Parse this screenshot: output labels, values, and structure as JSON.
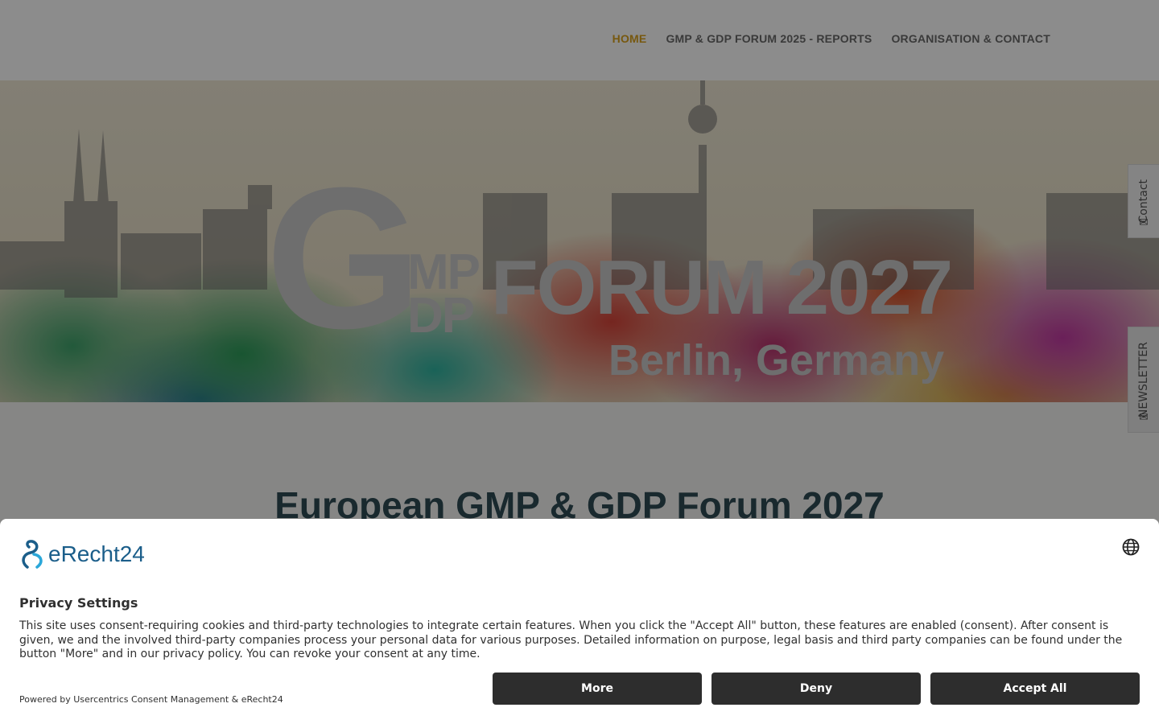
{
  "nav": {
    "items": [
      {
        "label": "HOME",
        "active": true
      },
      {
        "label": "GMP & GDP FORUM 2025 - REPORTS",
        "active": false
      },
      {
        "label": "ORGANISATION & CONTACT",
        "active": false
      }
    ]
  },
  "hero": {
    "logo_g": "G",
    "logo_mp": "MP",
    "logo_dp": "DP",
    "logo_forum": "FORUM 2027",
    "logo_city": "Berlin, Germany"
  },
  "side_tabs": {
    "contact": "Contact",
    "newsletter": "NEWSLETTER"
  },
  "main": {
    "title": "European GMP & GDP Forum 2027"
  },
  "consent": {
    "brand": "eRecht24",
    "heading": "Privacy Settings",
    "body": "This site uses consent-requiring cookies and third-party technologies to integrate certain features. When you click the \"Accept All\" button, these features are enabled (consent). After consent is given, we and the involved third-party companies process your personal data for various purposes. Detailed information on purpose, legal basis and third party companies can be found under the button \"More\" and in our privacy policy. You can revoke your consent at any time.",
    "powered_by": "Powered by Usercentrics Consent Management & eRecht24",
    "buttons": {
      "more": "More",
      "deny": "Deny",
      "accept_all": "Accept All"
    }
  },
  "colors": {
    "nav_active": "#d9a11c",
    "nav_text": "#6b6b6b",
    "title": "#2f4b55",
    "button_bg": "#2d2d2d",
    "brand": "#1b5e8a"
  },
  "icons": {
    "language": "globe-icon",
    "contact": "chat-icon",
    "newsletter": "mail-icon"
  }
}
